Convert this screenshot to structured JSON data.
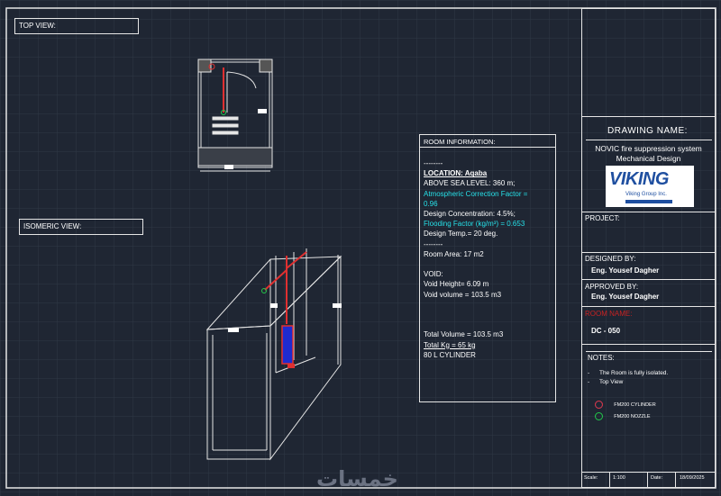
{
  "views": {
    "top_view_label": "TOP VIEW:",
    "isometric_view_label": "ISOMERIC VIEW:"
  },
  "room_info": {
    "header": "ROOM INFORMATION:",
    "lines": [
      {
        "text": "--------",
        "style": "plain"
      },
      {
        "text": "LOCATION: Aqaba",
        "style": "bold-underline"
      },
      {
        "text": "ABOVE SEA LEVEL: 360 m;",
        "style": "plain"
      },
      {
        "text": "Atmospheric Correction Factor =",
        "style": "cyan"
      },
      {
        "text": "0.96",
        "style": "cyan"
      },
      {
        "text": "Design Concentration: 4.5%;",
        "style": "plain"
      },
      {
        "text": "Flooding Factor (kg/m³) = 0.653",
        "style": "cyan"
      },
      {
        "text": "Design Temp.= 20 deg.",
        "style": "plain"
      },
      {
        "text": "--------",
        "style": "plain"
      },
      {
        "text": "Room Area: 17 m2",
        "style": "plain"
      },
      {
        "text": "",
        "style": "plain"
      },
      {
        "text": "VOID:",
        "style": "plain"
      },
      {
        "text": "Void Height= 6.09 m",
        "style": "plain"
      },
      {
        "text": "Void volume = 103.5 m3",
        "style": "plain"
      },
      {
        "text": "",
        "style": "plain"
      },
      {
        "text": "",
        "style": "plain"
      },
      {
        "text": "",
        "style": "plain"
      },
      {
        "text": "Total Volume = 103.5 m3",
        "style": "plain"
      },
      {
        "text": "Total Kg = 65 kg",
        "style": "underline"
      },
      {
        "text": "80 L CYLINDER",
        "style": "plain"
      }
    ]
  },
  "title_block": {
    "drawing_name_label": "DRAWING NAME:",
    "drawing_name_line1": "NOVIC fire suppression system",
    "drawing_name_line2": "Mechanical Design",
    "logo_text": "VIKING",
    "logo_sub": "Viking Group Inc.",
    "project_label": "PROJECT:",
    "designed_by_label": "DESIGNED BY:",
    "designed_by": "Eng. Yousef Dagher",
    "approved_by_label": "APPROVED BY:",
    "approved_by": "Eng. Yousef Dagher",
    "room_name_label": "ROOM NAME:",
    "room_name": "DC - 050",
    "notes_label": "NOTES:",
    "notes": [
      "The Room is fully isolated.",
      "Top View"
    ],
    "legend": [
      {
        "label": "FM200 CYLINDER",
        "color": "#2f6bff"
      },
      {
        "label": "FM200 NOZZLE",
        "color": "#22c94a"
      }
    ],
    "scale_label": "Scale:",
    "scale_value": "1:100",
    "date_label": "Date:",
    "date_value": "18/09/2025"
  },
  "watermark": "خمسات",
  "colors": {
    "background": "#1f2633",
    "grid": "#2f3846",
    "line": "#e6e6e6",
    "pipe": "#e03030",
    "cyan": "#26e0e8",
    "brand": "#1f4fa0"
  }
}
